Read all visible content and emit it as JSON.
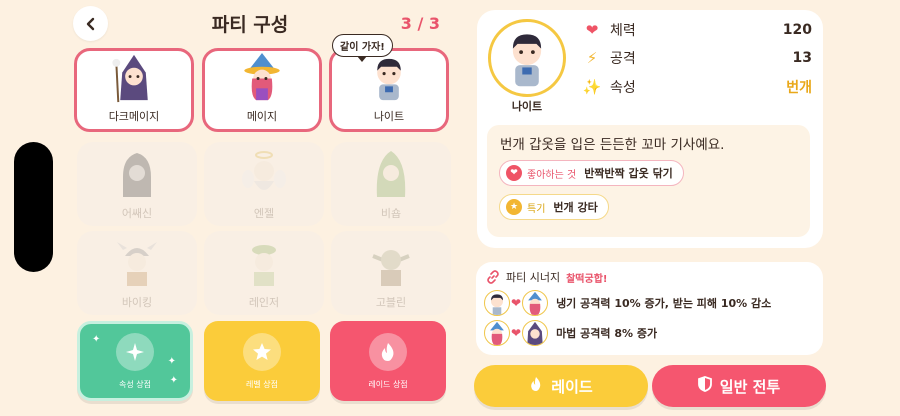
{
  "header": {
    "title": "파티 구성",
    "count": "3 / 3",
    "back_icon": "chevron-left-icon"
  },
  "speech_bubble": "같이 가자!",
  "slots": [
    {
      "name": "다크메이지",
      "state": "active",
      "icon": "dark-mage-icon"
    },
    {
      "name": "메이지",
      "state": "active",
      "icon": "mage-icon"
    },
    {
      "name": "나이트",
      "state": "active",
      "icon": "knight-icon"
    },
    {
      "name": "어쌔신",
      "state": "locked",
      "icon": "assassin-icon"
    },
    {
      "name": "엔젤",
      "state": "locked",
      "icon": "angel-icon"
    },
    {
      "name": "비숍",
      "state": "locked",
      "icon": "bishop-icon"
    },
    {
      "name": "바이킹",
      "state": "locked",
      "icon": "viking-icon"
    },
    {
      "name": "레인저",
      "state": "locked",
      "icon": "ranger-icon"
    },
    {
      "name": "고블린",
      "state": "locked",
      "icon": "goblin-icon"
    }
  ],
  "shops": [
    {
      "label": "속성 상점",
      "icon": "sparkle-icon"
    },
    {
      "label": "레벨 상점",
      "icon": "star-icon"
    },
    {
      "label": "레이드 상점",
      "icon": "flame-icon"
    }
  ],
  "detail": {
    "name": "나이트",
    "stats": [
      {
        "label": "체력",
        "value": "120",
        "icon": "heart-icon",
        "color": "#ef5466",
        "value_color": "#3a2a22"
      },
      {
        "label": "공격",
        "value": "13",
        "icon": "bolt-icon",
        "color": "#f2b632",
        "value_color": "#3a2a22"
      },
      {
        "label": "속성",
        "value": "번개",
        "icon": "sparkle-icon",
        "color": "#f2b632",
        "value_color": "#e9a81a"
      }
    ],
    "description": "번개 갑옷을 입은 든든한 꼬마 기사예요.",
    "like_label": "좋아하는 것",
    "like_value": "반짝반짝 갑옷 닦기",
    "skill_label": "특기",
    "skill_value": "번개 강타"
  },
  "synergy": {
    "title": "파티 시너지",
    "badge": "찰떡궁합!",
    "rows": [
      {
        "text": "냉기 공격력 10% 증가, 받는 피해 10% 감소"
      },
      {
        "text": "마법 공격력 8% 증가"
      }
    ]
  },
  "buttons": {
    "raid": "레이드",
    "battle": "일반 전투"
  },
  "colors": {
    "accent_pink": "#f5566f",
    "accent_yellow": "#fbcc3a",
    "accent_green": "#52c79a",
    "background": "#fdf1e1"
  }
}
